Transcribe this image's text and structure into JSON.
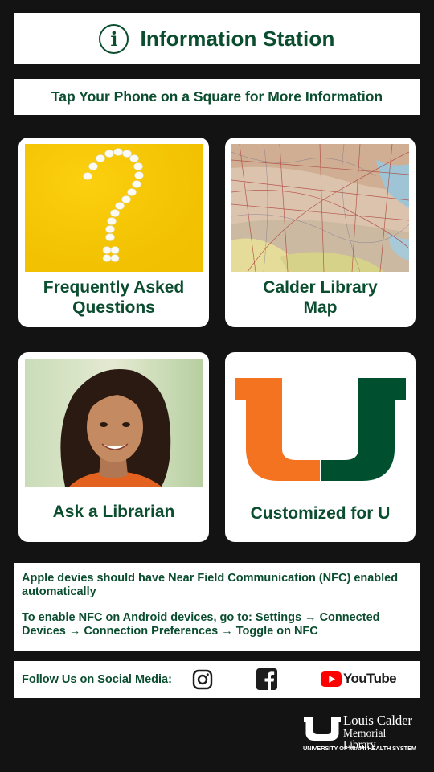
{
  "header": {
    "info_icon_glyph": "i",
    "title": "Information Station",
    "icon": "info-icon"
  },
  "subheader": {
    "text": "Tap Your Phone on a Square for More Information"
  },
  "tiles": [
    {
      "label_line1": "Frequently Asked",
      "label_line2": "Questions",
      "image": "question-mark-pills-image"
    },
    {
      "label_line1": "Calder Library",
      "label_line2": "Map",
      "image": "map-image"
    },
    {
      "label": "Ask a Librarian",
      "image": "librarian-photo"
    },
    {
      "label": "Customized for U",
      "image": "u-logo"
    }
  ],
  "nfc_info": {
    "apple": "Apple devies should have Near Field Communication (NFC) enabled automatically",
    "android": "To enable NFC on Android devices, go to: Settings → Connected Devices → Connection Preferences → Toggle on NFC"
  },
  "social": {
    "label": "Follow Us on Social Media:",
    "icons": [
      "instagram-icon",
      "facebook-icon",
      "youtube-icon"
    ],
    "youtube_text": "YouTube"
  },
  "logo": {
    "name_line1": "Louis Calder",
    "name_line2": "Memorial Library",
    "system": "UNIVERSITY OF MIAMI HEALTH SYSTEM"
  },
  "colors": {
    "background": "#131313",
    "panel": "#ffffff",
    "text_green": "#0b4d2f",
    "u_orange": "#f47321",
    "u_green": "#005030",
    "question_bg": "#f7c600",
    "youtube_red": "#ff0000"
  }
}
